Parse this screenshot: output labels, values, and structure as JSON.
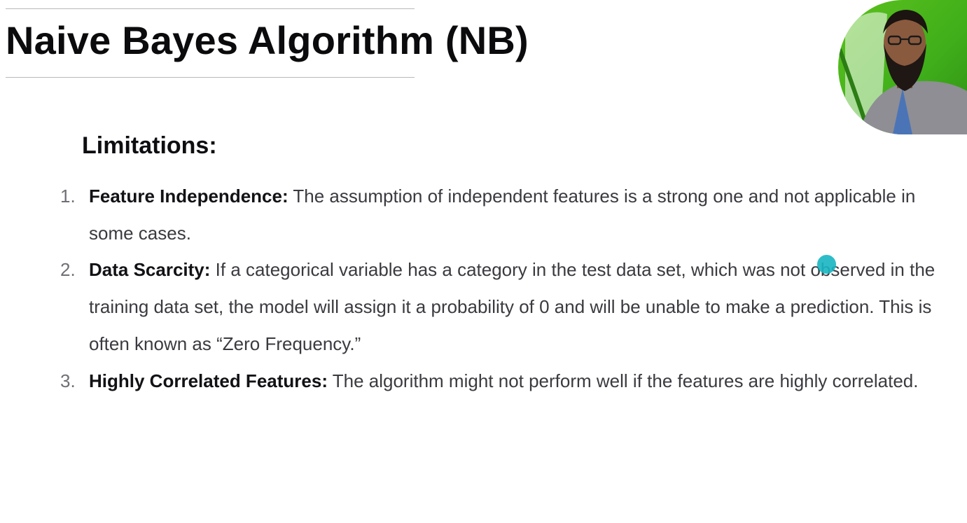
{
  "slide": {
    "title": "Naive Bayes Algorithm (NB)",
    "section_heading": "Limitations:",
    "limitations": [
      {
        "number": "1.",
        "term": "Feature Independence:",
        "text": "The assumption of independent features is a strong one and not applicable in some cases."
      },
      {
        "number": "2.",
        "term": "Data Scarcity:",
        "text": "If a categorical variable has a category in the test data set, which was not observed in the training data set, the model will assign it a probability of 0 and will be unable to make a prediction. This is often known as “Zero Frequency.”"
      },
      {
        "number": "3.",
        "term": "Highly Correlated Features:",
        "text": "The algorithm might not perform well if the features are highly correlated."
      }
    ]
  },
  "overlay": {
    "presenter_webcam": "presenter-video",
    "cursor_color": "#17b6c2",
    "webcam_background_color": "#3fae1a"
  }
}
